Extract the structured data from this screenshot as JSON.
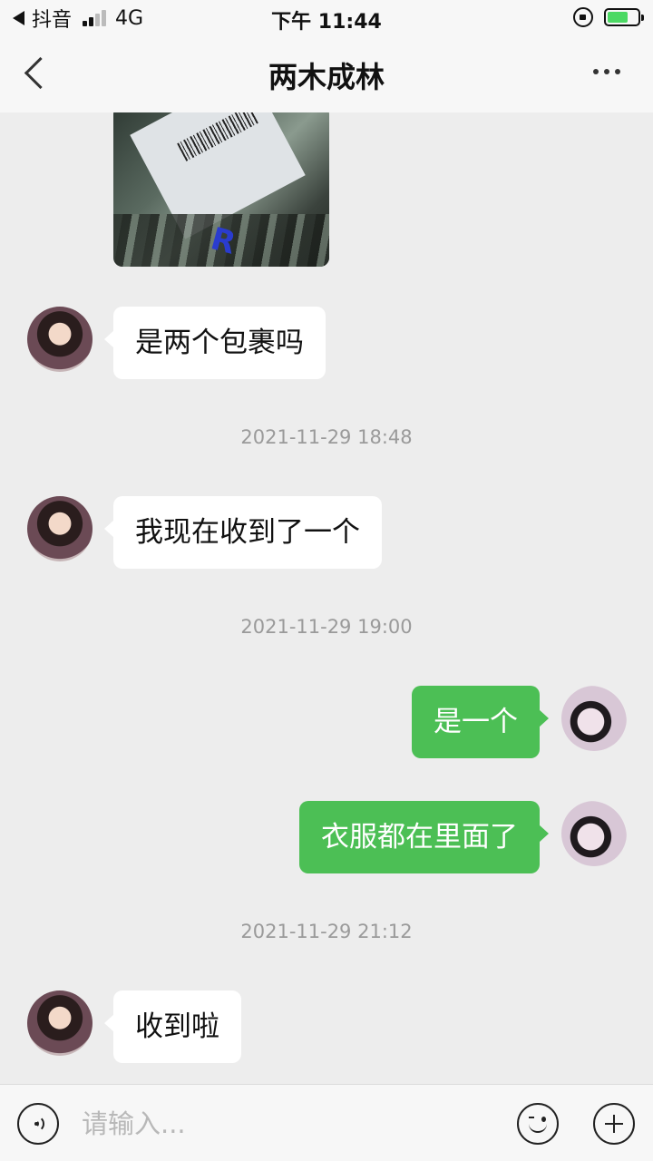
{
  "status_bar": {
    "back_app": "抖音",
    "network": "4G",
    "time": "下午 11:44"
  },
  "navbar": {
    "title": "两木成林"
  },
  "messages": [
    {
      "type": "image",
      "side": "left",
      "image_mark": "R"
    },
    {
      "type": "text",
      "side": "left",
      "text": "是两个包裹吗"
    },
    {
      "type": "time",
      "text": "2021-11-29 18:48"
    },
    {
      "type": "text",
      "side": "left",
      "text": "我现在收到了一个"
    },
    {
      "type": "time",
      "text": "2021-11-29 19:00"
    },
    {
      "type": "text",
      "side": "right",
      "text": "是一个"
    },
    {
      "type": "text",
      "side": "right",
      "text": "衣服都在里面了"
    },
    {
      "type": "time",
      "text": "2021-11-29 21:12"
    },
    {
      "type": "text",
      "side": "left",
      "text": "收到啦"
    }
  ],
  "input_bar": {
    "placeholder": "请输入..."
  },
  "colors": {
    "background": "#ededed",
    "outgoing_bubble": "#4cbf55",
    "incoming_bubble": "#ffffff",
    "timestamp": "#9a9a9a",
    "battery": "#4cd964"
  },
  "icons": [
    "back-arrow-icon",
    "signal-icon",
    "orientation-lock-icon",
    "battery-icon",
    "chevron-left-icon",
    "more-icon",
    "voice-icon",
    "emoji-icon",
    "plus-icon"
  ]
}
